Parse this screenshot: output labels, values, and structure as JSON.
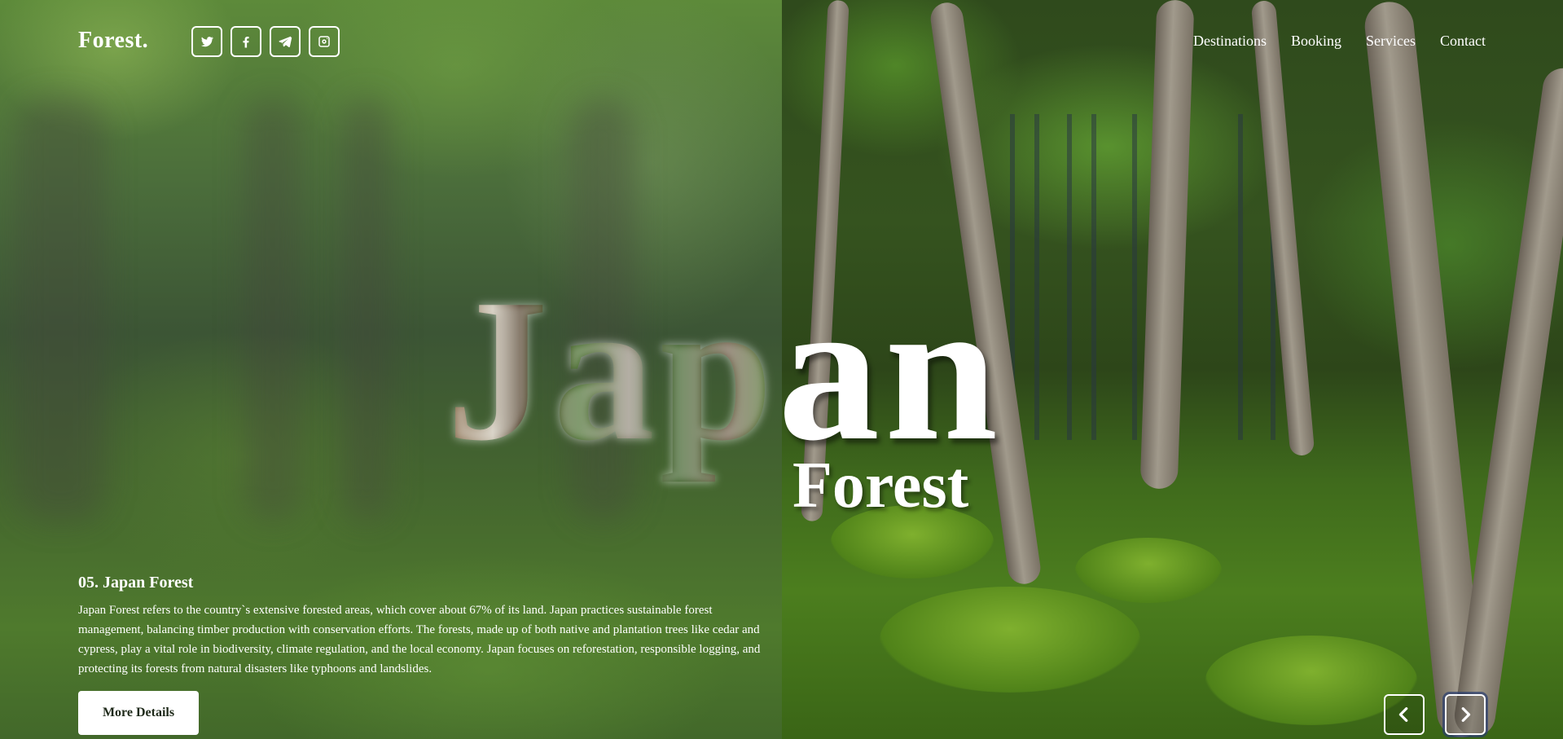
{
  "brand": {
    "logo": "Forest."
  },
  "socials": [
    {
      "name": "twitter-icon"
    },
    {
      "name": "facebook-icon"
    },
    {
      "name": "telegram-icon"
    },
    {
      "name": "instagram-icon"
    }
  ],
  "nav": {
    "items": [
      {
        "label": "Destinations"
      },
      {
        "label": "Booking"
      },
      {
        "label": "Services"
      },
      {
        "label": "Contact"
      }
    ]
  },
  "hero": {
    "title_dark": "Jap",
    "title_light": "an",
    "subtitle": "Forest"
  },
  "info": {
    "heading": "05. Japan Forest",
    "description": "Japan Forest refers to the country`s extensive forested areas, which cover about 67% of its land. Japan practices sustainable forest management, balancing timber production with conservation efforts. The forests, made up of both native and plantation trees like cedar and cypress, play a vital role in biodiversity, climate regulation, and the local economy. Japan focuses on reforestation, responsible logging, and protecting its forests from natural disasters like typhoons and landslides.",
    "button_label": "More Details"
  },
  "slider": {
    "prev_icon": "chevron-left-icon",
    "next_icon": "chevron-right-icon"
  },
  "colors": {
    "text": "#ffffff",
    "button_bg": "#ffffff",
    "button_text": "#1f2a1a"
  }
}
